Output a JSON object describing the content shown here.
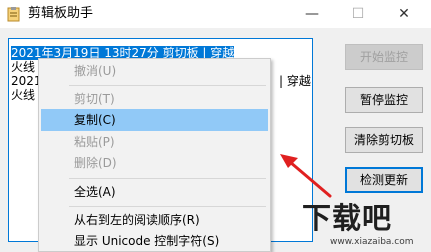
{
  "window": {
    "title": "剪辑板助手",
    "controls": {
      "minimize": "—",
      "maximize": "☐",
      "close": "✕"
    }
  },
  "textarea": {
    "lines": [
      {
        "text": "2021年3月19日 13时27分 剪切板 | 穿越",
        "selected": true
      },
      {
        "text": "火线",
        "selected": false
      },
      {
        "text": "2021",
        "selected": false
      },
      {
        "text": "火线",
        "selected": false
      }
    ],
    "tail_text": "| 穿越"
  },
  "buttons": [
    {
      "label": "开始监控",
      "disabled": true
    },
    {
      "label": "暂停监控",
      "disabled": false
    },
    {
      "label": "清除剪切板",
      "disabled": false
    },
    {
      "label": "检测更新",
      "disabled": false
    }
  ],
  "context_menu": {
    "items": [
      {
        "label": "撤消(U)",
        "disabled": true
      },
      {
        "label": "剪切(T)",
        "disabled": true
      },
      {
        "label": "复制(C)",
        "disabled": false,
        "highlighted": true
      },
      {
        "label": "粘贴(P)",
        "disabled": true
      },
      {
        "label": "删除(D)",
        "disabled": true
      },
      {
        "label": "全选(A)",
        "disabled": false
      },
      {
        "label": "从右到左的阅读顺序(R)",
        "disabled": false
      },
      {
        "label": "显示 Unicode 控制字符(S)",
        "disabled": false
      }
    ]
  },
  "watermark": {
    "logo_text": "下载吧",
    "url": "www.xiazaiba.com"
  },
  "colors": {
    "selection": "#0078d7",
    "menu_highlight": "#91c9f7",
    "arrow": "#e02020"
  }
}
